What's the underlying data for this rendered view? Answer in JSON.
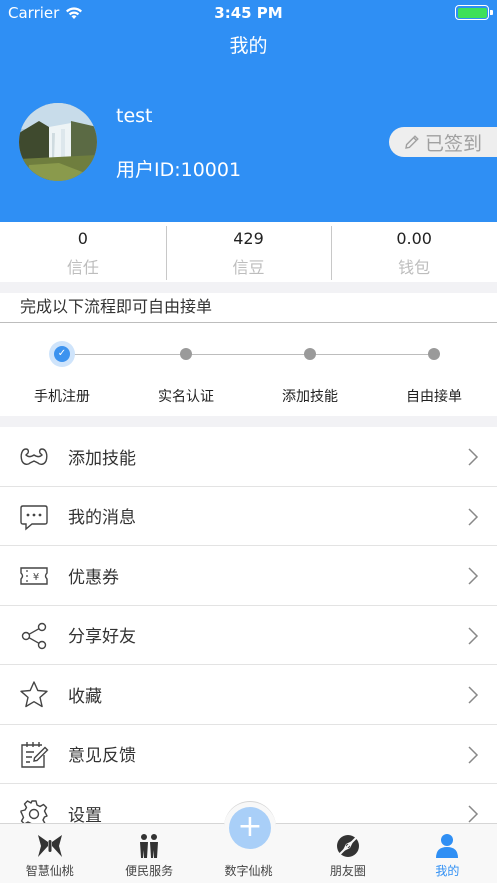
{
  "status_bar": {
    "carrier": "Carrier",
    "time": "3:45 PM"
  },
  "nav": {
    "title": "我的"
  },
  "profile": {
    "username": "test",
    "user_id": "用户ID:10001",
    "checkin_label": "已签到"
  },
  "stats": [
    {
      "value": "0",
      "label": "信任"
    },
    {
      "value": "429",
      "label": "信豆"
    },
    {
      "value": "0.00",
      "label": "钱包"
    }
  ],
  "flow": {
    "title": "完成以下流程即可自由接单",
    "steps": [
      "手机注册",
      "实名认证",
      "添加技能",
      "自由接单"
    ],
    "completed_steps": 1
  },
  "menu": [
    {
      "label": "添加技能",
      "icon": "muscle-icon"
    },
    {
      "label": "我的消息",
      "icon": "message-bubble-icon"
    },
    {
      "label": "优惠券",
      "icon": "coupon-icon"
    },
    {
      "label": "分享好友",
      "icon": "share-icon"
    },
    {
      "label": "收藏",
      "icon": "star-icon"
    },
    {
      "label": "意见反馈",
      "icon": "feedback-edit-icon"
    },
    {
      "label": "设置",
      "icon": "gear-icon"
    }
  ],
  "tabs": [
    {
      "label": "智慧仙桃",
      "icon": "butterfly-icon",
      "active": false
    },
    {
      "label": "便民服务",
      "icon": "people-icon",
      "active": false
    },
    {
      "label": "数字仙桃",
      "icon": "plus-icon",
      "active": false
    },
    {
      "label": "朋友圈",
      "icon": "compass-icon",
      "active": false
    },
    {
      "label": "我的",
      "icon": "user-icon",
      "active": true
    }
  ],
  "colors": {
    "primary": "#2f8ff4",
    "battery": "#3ee05a"
  }
}
